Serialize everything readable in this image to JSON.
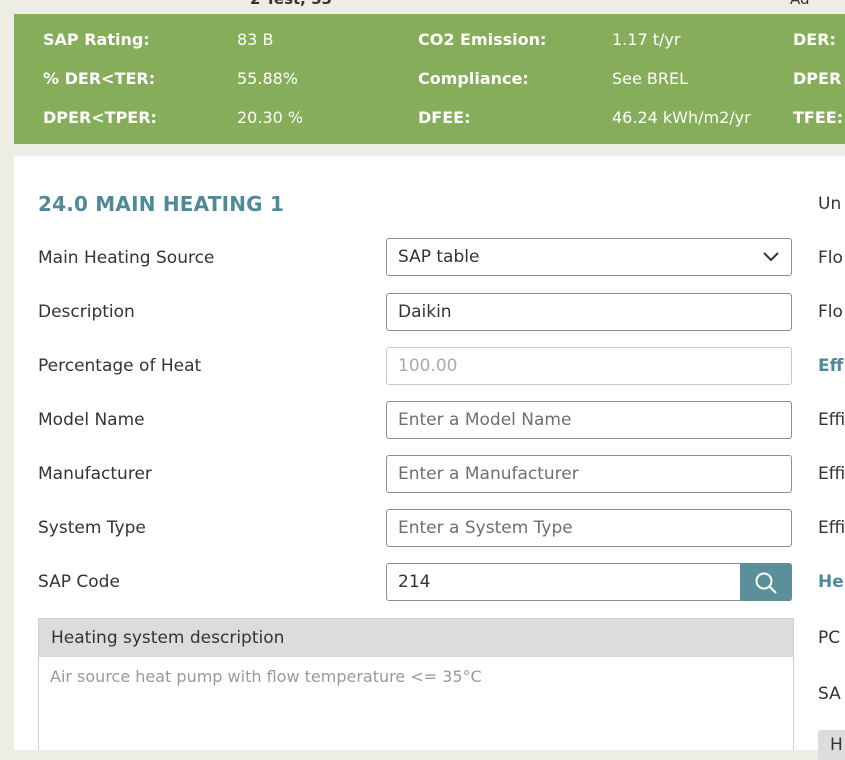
{
  "topbar": {
    "left_cut": "2 Test, 53",
    "right_cut": "Ad"
  },
  "summary": {
    "sap_rating_label": "SAP Rating:",
    "sap_rating_value": "83 B",
    "co2_label": "CO2 Emission:",
    "co2_value": "1.17 t/yr",
    "der_label": "DER:",
    "der_ter_label": "% DER<TER:",
    "der_ter_value": "55.88%",
    "compliance_label": "Compliance:",
    "compliance_value": "See BREL",
    "dper_label": "DPER",
    "dper_tper_label": "DPER<TPER:",
    "dper_tper_value": "20.30 %",
    "dfee_label": "DFEE:",
    "dfee_value": "46.24 kWh/m2/yr",
    "tfee_label": "TFEE:"
  },
  "main_heating": {
    "title": "24.0 MAIN HEATING 1",
    "main_source_label": "Main Heating Source",
    "main_source_value": "SAP table",
    "description_label": "Description",
    "description_value": "Daikin",
    "percentage_label": "Percentage of Heat",
    "percentage_value": "100.00",
    "model_label": "Model Name",
    "model_placeholder": "Enter a Model Name",
    "manufacturer_label": "Manufacturer",
    "manufacturer_placeholder": "Enter a Manufacturer",
    "system_type_label": "System Type",
    "system_type_placeholder": "Enter a System Type",
    "sap_code_label": "SAP Code",
    "sap_code_value": "214",
    "heating_desc_header": "Heating system description",
    "heating_desc_text": "Air source heat pump with flow temperature <= 35°C"
  },
  "side_column": {
    "item1": "Un",
    "item2": "Flo",
    "item3": "Flo",
    "item4": "Eff",
    "item5": "Effi",
    "item6": "Effi",
    "item7": "Effi",
    "item8": "He",
    "item9": "PC",
    "item10": "SA",
    "item11": "H"
  }
}
